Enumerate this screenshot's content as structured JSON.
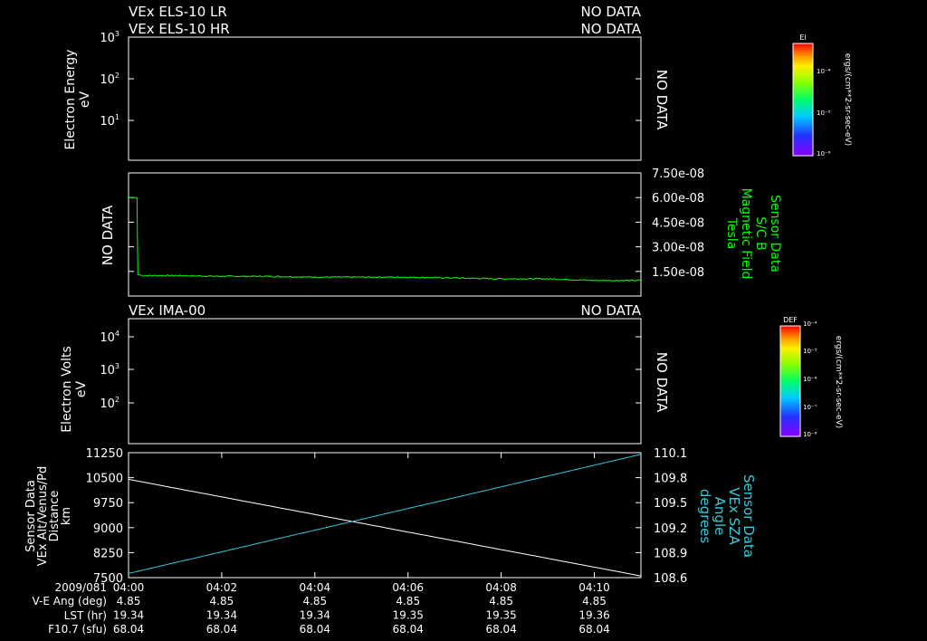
{
  "header": {
    "lines": [
      {
        "left": "VEx ELS-10 LR",
        "right": "NO DATA"
      },
      {
        "left": "VEx ELS-10 HR",
        "right": "NO DATA"
      }
    ]
  },
  "no_data": "NO DATA",
  "chart_data": [
    {
      "type": "heatmap",
      "panel": "electron-energy",
      "ylabel": [
        "Electron Energy",
        "eV"
      ],
      "yscale": "log",
      "yticks": [
        {
          "base": "10",
          "exp": "1"
        },
        {
          "base": "10",
          "exp": "2"
        },
        {
          "base": "10",
          "exp": "3"
        }
      ],
      "status": "NO DATA",
      "colorbar": {
        "label": "El",
        "unit": "ergs/(cm**2-sr-sec-eV)",
        "ticks": [
          "10⁻⁴",
          "10⁻⁵",
          "10⁻⁶"
        ]
      }
    },
    {
      "type": "line",
      "panel": "magnetic-field",
      "side_label": "NO DATA",
      "ylabel": [
        "Sensor Data",
        "S/C B",
        "Magnetic Field",
        "Tesla"
      ],
      "ylim": [
        0,
        7.5e-08
      ],
      "yticks": [
        "7.50e-08",
        "6.00e-08",
        "4.50e-08",
        "3.00e-08",
        "1.50e-08"
      ],
      "color": "#00ff00",
      "xlim": [
        0,
        11
      ],
      "x": [
        0,
        0.12,
        0.18,
        0.2,
        0.3,
        1,
        2,
        3,
        4,
        5,
        6,
        7,
        8,
        9,
        10,
        11
      ],
      "y": [
        6e-08,
        6e-08,
        6e-08,
        1.3e-08,
        1.25e-08,
        1.25e-08,
        1.2e-08,
        1.2e-08,
        1.15e-08,
        1.15e-08,
        1.15e-08,
        1.1e-08,
        1.05e-08,
        1.05e-08,
        9.5e-09,
        9.5e-09
      ]
    },
    {
      "type": "heatmap",
      "panel": "electron-volts",
      "title": {
        "left": "VEx IMA-00",
        "right": "NO DATA"
      },
      "ylabel": [
        "Electron Volts",
        "eV"
      ],
      "yscale": "log",
      "yticks": [
        {
          "base": "10",
          "exp": "2"
        },
        {
          "base": "10",
          "exp": "3"
        },
        {
          "base": "10",
          "exp": "4"
        }
      ],
      "status": "NO DATA",
      "colorbar": {
        "label": "DEF",
        "unit": "ergs/(cm**2-sr-sec-eV)",
        "ticks": [
          "10⁻⁴",
          "10⁻⁵",
          "10⁻⁶",
          "10⁻⁷",
          "10⁻⁸"
        ]
      }
    },
    {
      "type": "line",
      "panel": "distance-sza",
      "ylabel_left": [
        "Sensor Data",
        "VEx Alt/Venus/Pd",
        "Distance",
        "km"
      ],
      "ylim_left": [
        7500,
        11250
      ],
      "yticks_left": [
        "11250",
        "10500",
        "9750",
        "9000",
        "8250",
        "7500"
      ],
      "ylabel_right": [
        "Sensor Data",
        "VEx SZA",
        "Angle",
        "degrees"
      ],
      "ylim_right": [
        108.6,
        110.1
      ],
      "yticks_right": [
        "110.1",
        "109.8",
        "109.5",
        "109.2",
        "108.9",
        "108.6"
      ],
      "xlim": [
        0,
        11
      ],
      "xticks": [
        "04:00",
        "04:02",
        "04:04",
        "04:06",
        "04:08",
        "04:10"
      ],
      "series": [
        {
          "axis": "left",
          "color": "#ffffff",
          "x": [
            0,
            11
          ],
          "y": [
            10450,
            7550
          ]
        },
        {
          "axis": "right",
          "color": "#33ccdd",
          "x": [
            0,
            11
          ],
          "y": [
            108.65,
            110.08
          ]
        }
      ]
    }
  ],
  "footer": {
    "date": "2009/081",
    "rows": [
      {
        "label": "V-E Ang (deg)",
        "values": [
          "4.85",
          "4.85",
          "4.85",
          "4.85",
          "4.85",
          "4.85"
        ]
      },
      {
        "label": "LST (hr)",
        "values": [
          "19.34",
          "19.34",
          "19.34",
          "19.35",
          "19.35",
          "19.36"
        ]
      },
      {
        "label": "F10.7 (sfu)",
        "values": [
          "68.04",
          "68.04",
          "68.04",
          "68.04",
          "68.04",
          "68.04"
        ]
      }
    ]
  }
}
